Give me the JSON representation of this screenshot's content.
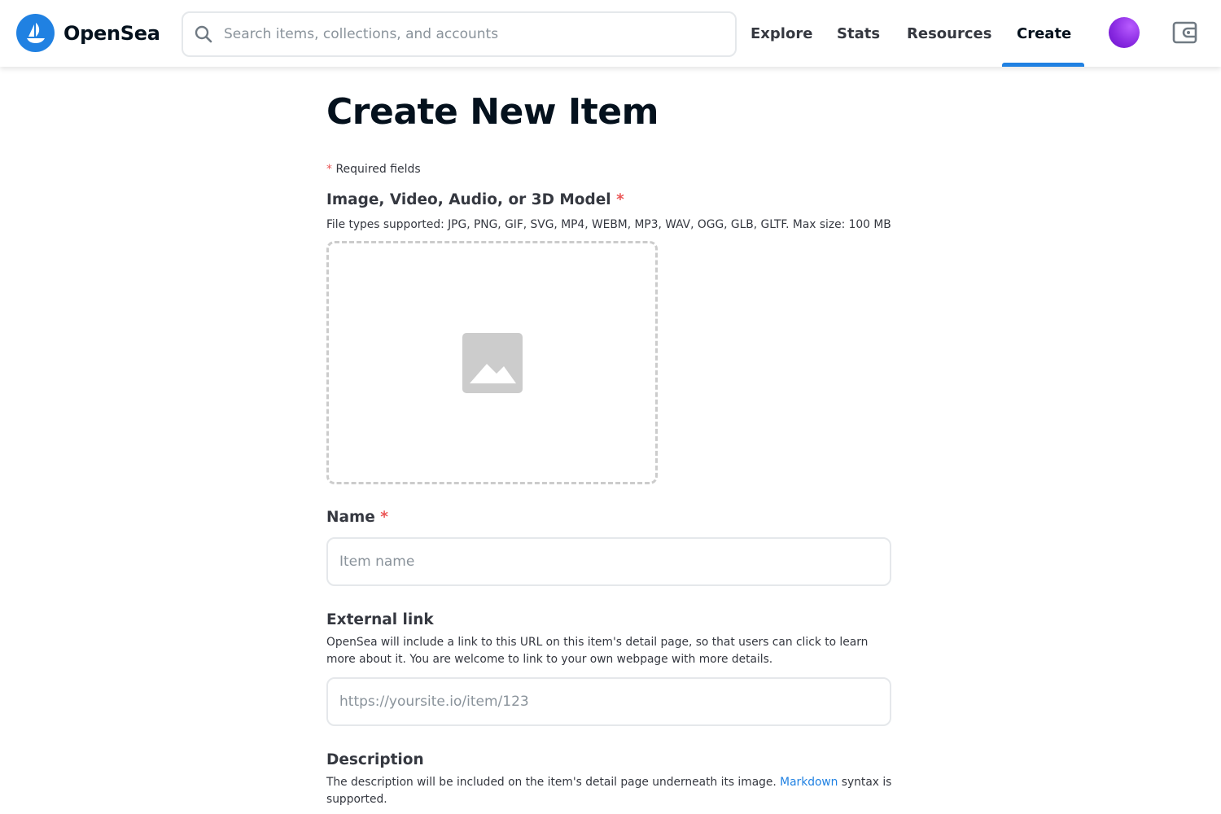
{
  "header": {
    "logo_text": "OpenSea",
    "search_placeholder": "Search items, collections, and accounts",
    "nav": {
      "explore": "Explore",
      "stats": "Stats",
      "resources": "Resources",
      "create": "Create"
    },
    "active_nav": "Create",
    "accent_color": "#2081e2",
    "icons": [
      "opensea-logo-icon",
      "search-icon",
      "avatar",
      "wallet-icon"
    ]
  },
  "main": {
    "title": "Create New Item",
    "required_asterisk": "*",
    "required_note": "Required fields",
    "media": {
      "label": "Image, Video, Audio, or 3D Model",
      "required_mark": "*",
      "description": "File types supported: JPG, PNG, GIF, SVG, MP4, WEBM, MP3, WAV, OGG, GLB, GLTF. Max size: 100 MB",
      "icon": "image-placeholder-icon"
    },
    "name": {
      "label": "Name",
      "required_mark": "*",
      "placeholder": "Item name",
      "value": ""
    },
    "external_link": {
      "label": "External link",
      "description": "OpenSea will include a link to this URL on this item's detail page, so that users can click to learn more about it. You are welcome to link to your own webpage with more details.",
      "placeholder": "https://yoursite.io/item/123",
      "value": ""
    },
    "description": {
      "label": "Description",
      "text_before": "The description will be included on the item's detail page underneath its image. ",
      "link_text": "Markdown",
      "text_after": " syntax is supported."
    }
  }
}
